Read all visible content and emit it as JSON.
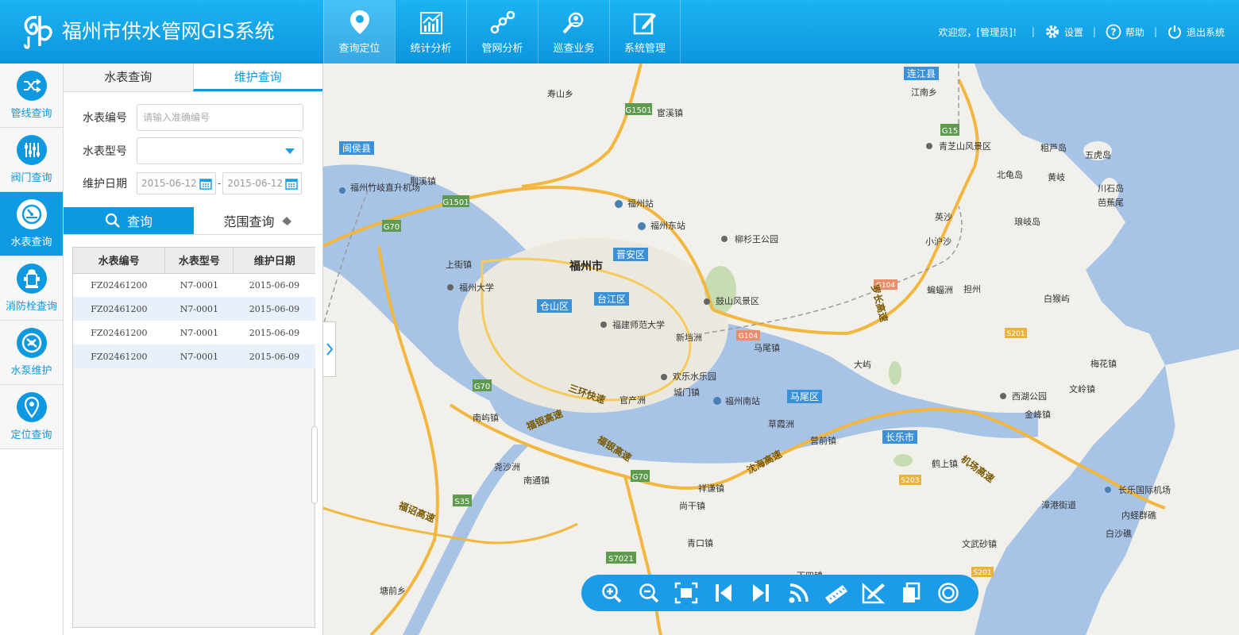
{
  "app": {
    "title": "福州市供水管网GIS系统"
  },
  "nav": [
    {
      "label": "查询定位",
      "icon": "location-pin-icon",
      "active": true
    },
    {
      "label": "统计分析",
      "icon": "bar-chart-icon"
    },
    {
      "label": "管网分析",
      "icon": "network-icon"
    },
    {
      "label": "巡查业务",
      "icon": "patrol-search-icon"
    },
    {
      "label": "系统管理",
      "icon": "edit-icon"
    }
  ],
  "user": {
    "welcome": "欢迎您，[管理员]！",
    "settings": "设置",
    "help": "帮助",
    "logout": "退出系统"
  },
  "sidebar": [
    {
      "label": "管线查询",
      "icon": "shuffle-icon"
    },
    {
      "label": "阀门查询",
      "icon": "sliders-icon"
    },
    {
      "label": "水表查询",
      "icon": "gauge-icon",
      "active": true
    },
    {
      "label": "消防栓查询",
      "icon": "hydrant-icon"
    },
    {
      "label": "水泵维护",
      "icon": "pump-icon"
    },
    {
      "label": "定位查询",
      "icon": "pin-icon"
    }
  ],
  "panel": {
    "tabs": [
      "水表查询",
      "维护查询"
    ],
    "active_tab": 1,
    "form": {
      "meter_no_label": "水表编号",
      "meter_no_placeholder": "请输入准确编号",
      "meter_type_label": "水表型号",
      "date_label": "维护日期",
      "date_from": "2015-06-12",
      "date_sep": "-",
      "date_to": "2015-06-12"
    },
    "query_btn": "查询",
    "range_btn": "范围查询",
    "table": {
      "columns": [
        "水表编号",
        "水表型号",
        "维护日期"
      ],
      "rows": [
        [
          "FZ02461200",
          "N7-0001",
          "2015-06-09"
        ],
        [
          "FZ02461200",
          "N7-0001",
          "2015-06-09"
        ],
        [
          "FZ02461200",
          "N7-0001",
          "2015-06-09"
        ],
        [
          "FZ02461200",
          "N7-0001",
          "2015-06-09"
        ]
      ]
    }
  },
  "map": {
    "districts": [
      "连江县",
      "闽侯县",
      "晋安区",
      "台江区",
      "仓山区",
      "马尾区",
      "长乐市"
    ],
    "city": "福州市",
    "places": [
      "寿山乡",
      "江南乡",
      "宦溪镇",
      "青芝山风景区",
      "粗芦岛",
      "五虎岛",
      "北龟岛",
      "黄岐",
      "川石岛",
      "芭蕉尾",
      "琅岐岛",
      "荆溪镇",
      "福州竹岐直升机场",
      "福州站",
      "福州东站",
      "柳杉王公园",
      "英沙",
      "小沪沙",
      "上街镇",
      "福州大学",
      "蝙蝠洲",
      "担州",
      "白猴屿",
      "鼓山风景区",
      "福建师范大学",
      "新垱洲",
      "马尾镇",
      "大屿",
      "梅花镇",
      "南屿镇",
      "官产洲",
      "城门镇",
      "福州南站",
      "欢乐水乐园",
      "西湖公园",
      "文岭镇",
      "金峰镇",
      "草霞洲",
      "营前镇",
      "鹤上镇",
      "尧沙洲",
      "南通镇",
      "祥谦镇",
      "尚干镇",
      "长乐国际机场",
      "漳港街道",
      "内蛏群礁",
      "白沙礁",
      "青口镇",
      "文武砂镇",
      "塘前乡",
      "下四镇"
    ],
    "roads": [
      "G1501",
      "G15",
      "G70",
      "G104",
      "S201",
      "S203",
      "S35",
      "S7021",
      "沈海高速",
      "福银高速",
      "三环快速",
      "机场高速",
      "罗长高速",
      "福诏高速"
    ]
  },
  "toolbar": [
    "zoom-in-icon",
    "zoom-out-icon",
    "full-extent-icon",
    "previous-extent-icon",
    "next-extent-icon",
    "layers-feed-icon",
    "measure-distance-icon",
    "measure-area-icon",
    "copy-icon",
    "clear-icon"
  ]
}
